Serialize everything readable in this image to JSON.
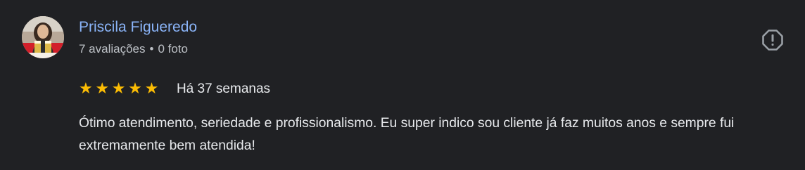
{
  "review": {
    "author": {
      "name": "Priscila Figueredo",
      "reviews_count": "7 avaliações",
      "separator": "•",
      "photos_count": "0 foto",
      "avatar_icon": "profile-photo"
    },
    "rating": {
      "stars": 5,
      "max_stars": 5,
      "star_color": "#fbbc04"
    },
    "date": "Há 37 semanas",
    "text": "Ótimo atendimento, seriedade e profissionalismo. Eu super indico sou cliente já faz muitos anos e sempre fui extremamente bem atendida!",
    "report_icon": "report-octagon-icon"
  },
  "colors": {
    "background": "#202124",
    "name": "#8ab4f8",
    "meta": "#bdc1c6",
    "text": "#e8eaed",
    "icon": "#9aa0a6"
  }
}
